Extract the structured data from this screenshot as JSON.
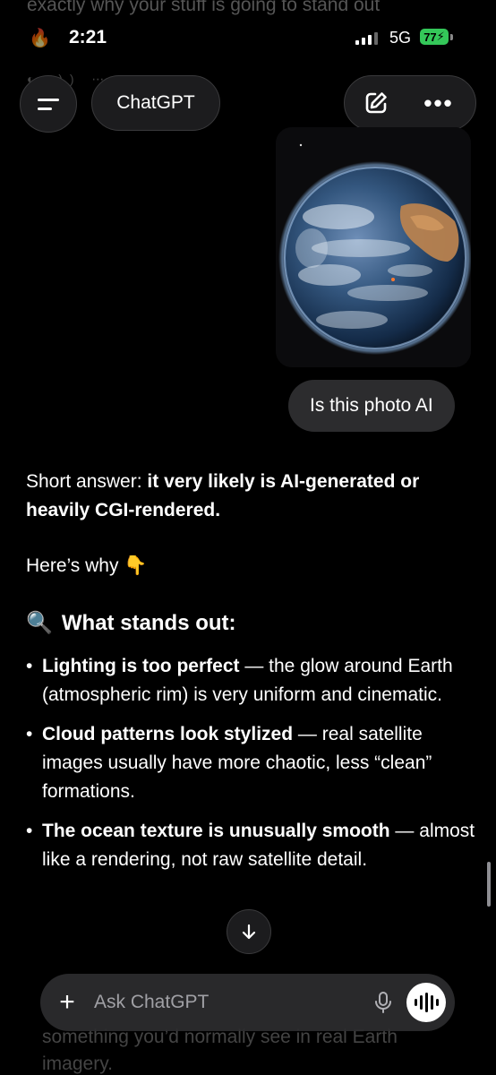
{
  "overlay": {
    "top_text": "exactly why your stuff is going to stand out",
    "bottom_text_1": "something you’d normally see in real Earth",
    "bottom_text_2": "imagery."
  },
  "status_bar": {
    "time": "2:21",
    "network": "5G",
    "battery": "77"
  },
  "header": {
    "title": "ChatGPT"
  },
  "conversation": {
    "user_message": "Is this photo AI",
    "answer_intro_plain": "Short answer: ",
    "answer_intro_bold": "it very likely is AI-generated or heavily CGI-rendered.",
    "heres_why": "Here’s why",
    "heres_why_emoji": "👇",
    "section_icon": "🔍",
    "section_title": "What stands out:",
    "points": [
      {
        "bold": "Lighting is too perfect",
        "text": " — the glow around Earth (atmospheric rim) is very uniform and cinematic."
      },
      {
        "bold": "Cloud patterns look stylized",
        "text": " — real satellite images usually have more chaotic, less “clean” formations."
      },
      {
        "bold": "The ocean texture is unusually smooth",
        "text": " — almost like a rendering, not raw satellite detail."
      }
    ]
  },
  "composer": {
    "placeholder": "Ask ChatGPT"
  },
  "colors": {
    "background": "#000000",
    "pill": "#1c1c1e",
    "user_bubble": "#2c2c2e",
    "battery": "#34c759"
  }
}
